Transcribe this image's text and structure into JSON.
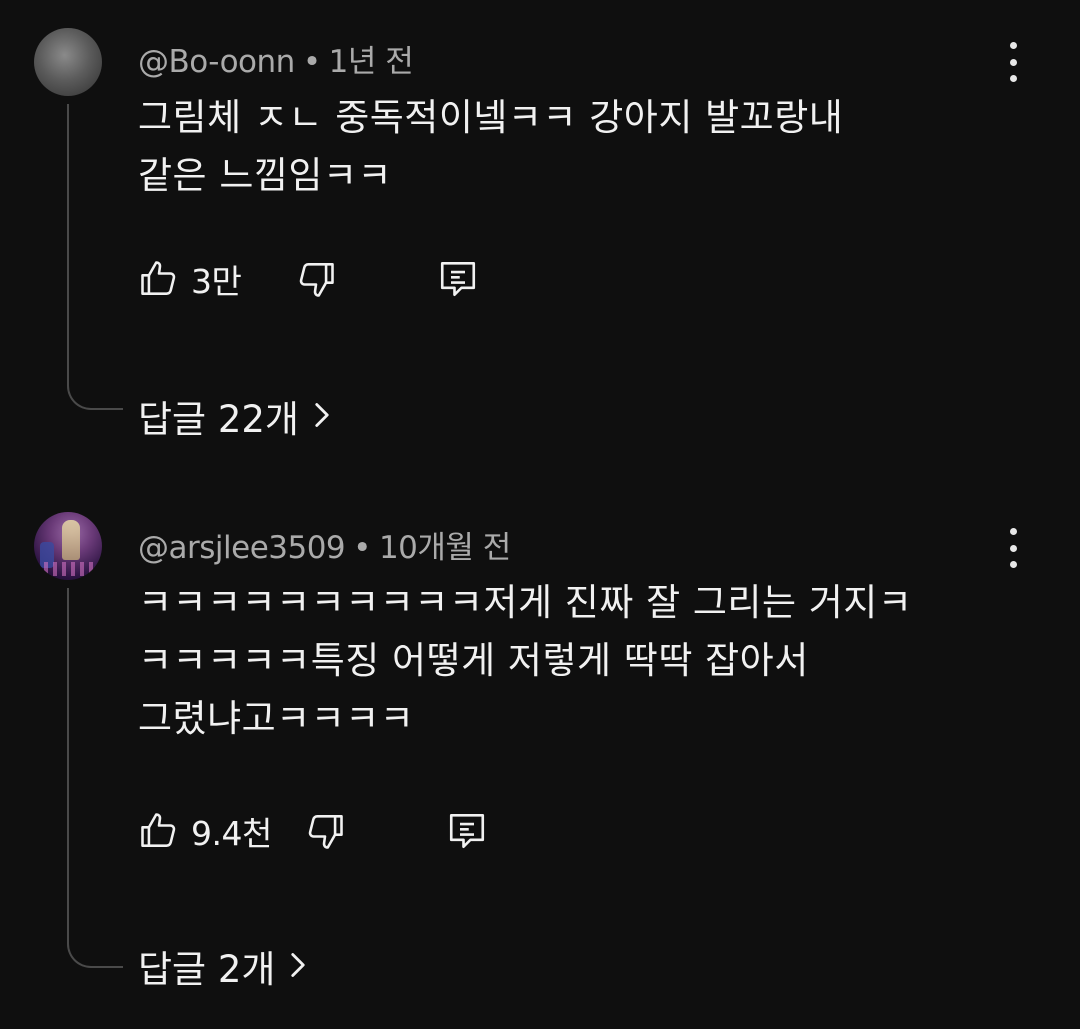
{
  "comments": [
    {
      "author": "@Bo-oonn",
      "separator": "•",
      "time": "1년 전",
      "lines": [
        "그림체 ㅈㄴ 중독적이넼ㅋㅋ 강아지 발꼬랑내",
        "같은 느낌임ㅋㅋ"
      ],
      "likes": "3만",
      "replies": "답글 22개",
      "icons": [
        "like-icon",
        "dislike-icon",
        "reply-icon",
        "more-vert-icon",
        "chevron-right-icon"
      ]
    },
    {
      "author": "@arsjlee3509",
      "separator": "•",
      "time": "10개월 전",
      "lines": [
        "ㅋㅋㅋㅋㅋㅋㅋㅋㅋㅋ저게 진짜 잘 그리는 거지ㅋ",
        "ㅋㅋㅋㅋㅋ특징 어떻게 저렇게 딱딱 잡아서",
        "그렸냐고ㅋㅋㅋㅋ"
      ],
      "likes": "9.4천",
      "replies": "답글 2개",
      "icons": [
        "like-icon",
        "dislike-icon",
        "reply-icon",
        "more-vert-icon",
        "chevron-right-icon"
      ]
    }
  ],
  "colors": {
    "background": "#0f0f0f",
    "text": "#f1f1f1",
    "meta": "#aaaaaa",
    "thread_line": "#4a4a4a"
  }
}
